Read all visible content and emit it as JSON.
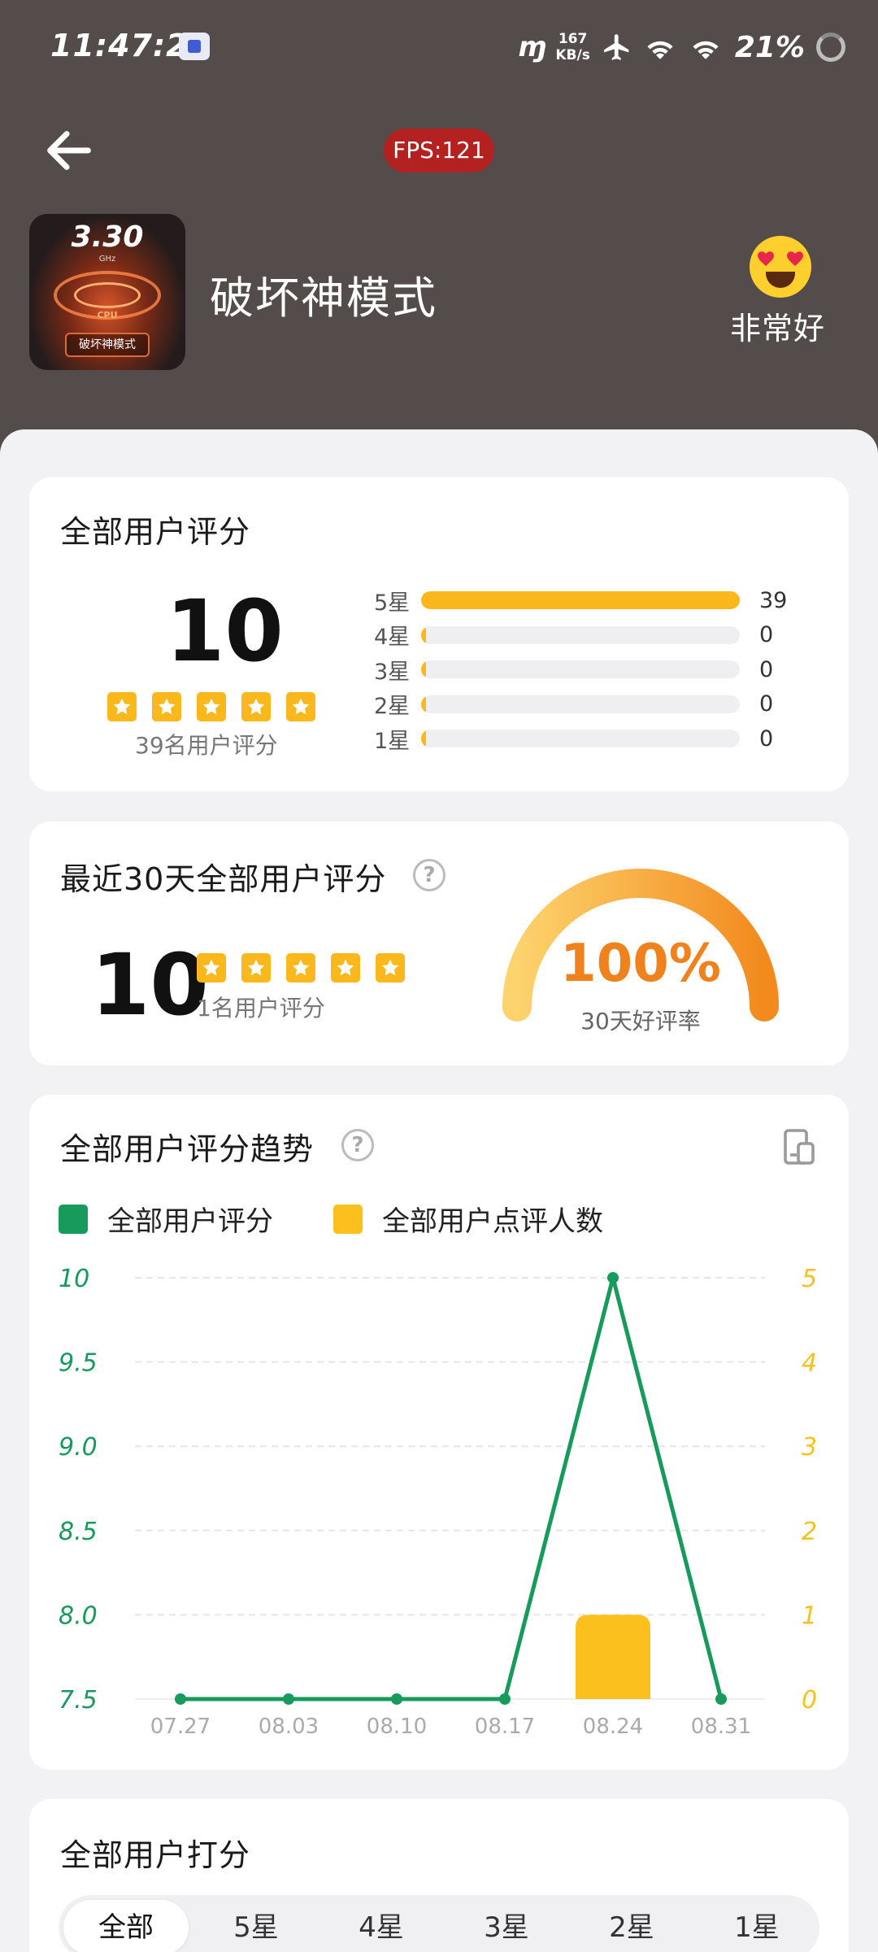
{
  "status_bar": {
    "time": "11:47:23",
    "net_speed_value": "167",
    "net_speed_unit": "KB/s",
    "battery": "21%"
  },
  "fps_badge": "FPS:121",
  "app": {
    "icon_freq": "3.30",
    "icon_unit": "GHz",
    "icon_cpu": "CPU",
    "icon_tag": "破坏神模式",
    "title": "破坏神模式"
  },
  "mood": {
    "label": "非常好",
    "icon": "smiling-face-heart-eyes-icon"
  },
  "overall": {
    "title": "全部用户评分",
    "score": "10",
    "stars_count": 5,
    "users_text": "39名用户评分",
    "distribution": [
      {
        "label": "5星",
        "count": "39",
        "fraction": 1.0
      },
      {
        "label": "4星",
        "count": "0",
        "fraction": 0
      },
      {
        "label": "3星",
        "count": "0",
        "fraction": 0
      },
      {
        "label": "2星",
        "count": "0",
        "fraction": 0
      },
      {
        "label": "1星",
        "count": "0",
        "fraction": 0
      }
    ]
  },
  "recent": {
    "title": "最近30天全部用户评分",
    "score": "10",
    "users_text": "1名用户评分",
    "rate_value": "100%",
    "rate_fraction": 1.0,
    "rate_label": "30天好评率"
  },
  "trend": {
    "title": "全部用户评分趋势",
    "legend_score": "全部用户评分",
    "legend_count": "全部用户点评人数"
  },
  "chart_data": {
    "type": "line",
    "title": "全部用户评分趋势",
    "categories": [
      "07.27",
      "08.03",
      "08.10",
      "08.17",
      "08.24",
      "08.31"
    ],
    "series": [
      {
        "name": "全部用户评分",
        "type": "line",
        "axis": "left",
        "values": [
          7.5,
          7.5,
          7.5,
          7.5,
          10,
          7.5
        ]
      },
      {
        "name": "全部用户点评人数",
        "type": "bar",
        "axis": "right",
        "values": [
          0,
          0,
          0,
          0,
          1,
          0
        ]
      }
    ],
    "y_left_ticks": [
      "7.5",
      "8.0",
      "8.5",
      "9.0",
      "9.5",
      "10"
    ],
    "ylim_left": [
      7.5,
      10
    ],
    "y_right_ticks": [
      "0",
      "1",
      "2",
      "3",
      "4",
      "5"
    ],
    "ylim_right": [
      0,
      5
    ],
    "grid": true,
    "legend_position": "top-left",
    "colors": {
      "line": "#189a5c",
      "bar": "#fbbf1e"
    }
  },
  "scores": {
    "title": "全部用户打分",
    "tabs": [
      "全部",
      "5星",
      "4星",
      "3星",
      "2星",
      "1星"
    ]
  },
  "colors": {
    "header_bg": "#534c4a",
    "star": "#fbb81c",
    "green": "#189a5c",
    "orange": "#f0821e"
  }
}
